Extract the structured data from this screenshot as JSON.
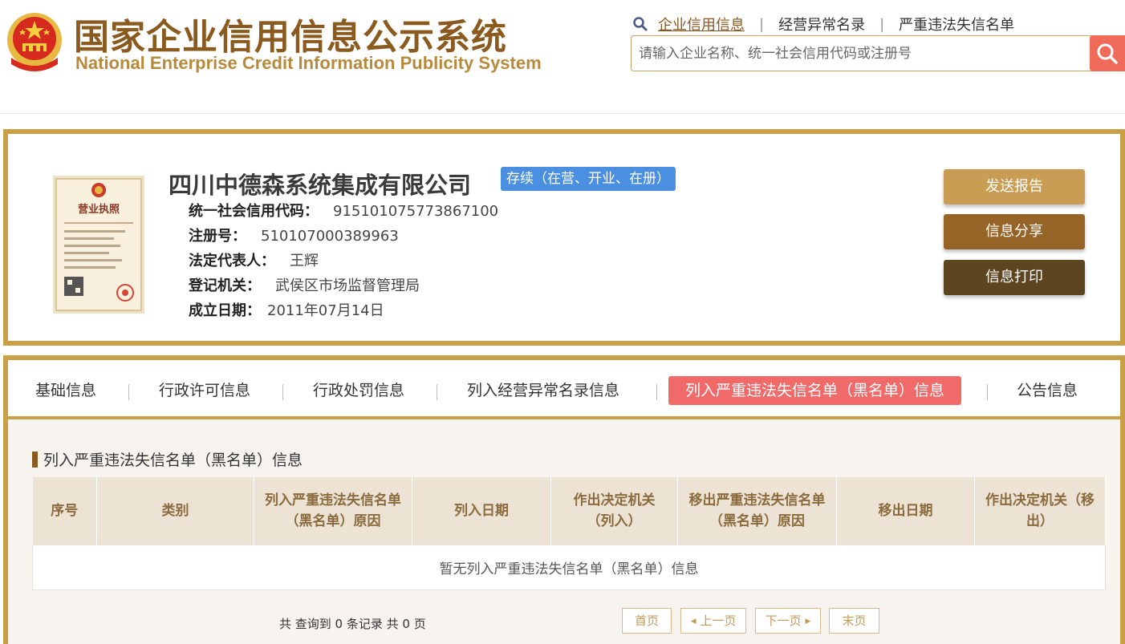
{
  "header": {
    "title_cn": "国家企业信用信息公示系统",
    "title_en": "National Enterprise Credit Information Publicity System",
    "nav": [
      "企业信用信息",
      "经营异常名录",
      "严重违法失信名单"
    ],
    "nav_separator": "|",
    "search_placeholder": "请输入企业名称、统一社会信用代码或注册号"
  },
  "company": {
    "name": "四川中德森系统集成有限公司",
    "status": "存续（在营、开业、在册）",
    "fields": [
      {
        "label": "统一社会信用代码：",
        "value": "915101075773867100"
      },
      {
        "label": "注册号：",
        "value": "510107000389963"
      },
      {
        "label": "法定代表人：",
        "value": "王辉"
      },
      {
        "label": "登记机关：",
        "value": "武侯区市场监督管理局"
      },
      {
        "label": "成立日期：",
        "value": "2011年07月14日"
      }
    ],
    "license_title": "营业执照"
  },
  "actions": {
    "send_report": "发送报告",
    "share": "信息分享",
    "print": "信息打印"
  },
  "tabs": [
    "基础信息",
    "行政许可信息",
    "行政处罚信息",
    "列入经营异常名录信息",
    "列入严重违法失信名单（黑名单）信息",
    "公告信息"
  ],
  "active_tab_index": 4,
  "section": {
    "title": "列入严重违法失信名单（黑名单）信息",
    "columns": [
      "序号",
      "类别",
      "列入严重违法失信名单（黑名单）原因",
      "列入日期",
      "作出决定机关（列入）",
      "移出严重违法失信名单（黑名单）原因",
      "移出日期",
      "作出决定机关（移出）"
    ],
    "empty_text": "暂无列入严重违法失信名单（黑名单）信息"
  },
  "pagination": {
    "summary": "共 查询到 0 条记录 共 0 页",
    "first": "首页",
    "prev": "上一页",
    "next": "下一页",
    "last": "末页"
  },
  "colors": {
    "brand_brown": "#8a5a1e",
    "gold_border": "#c9a046",
    "active_tab": "#f06a6a",
    "status_badge": "#4a8fe0",
    "search_button": "#f06a5a"
  }
}
